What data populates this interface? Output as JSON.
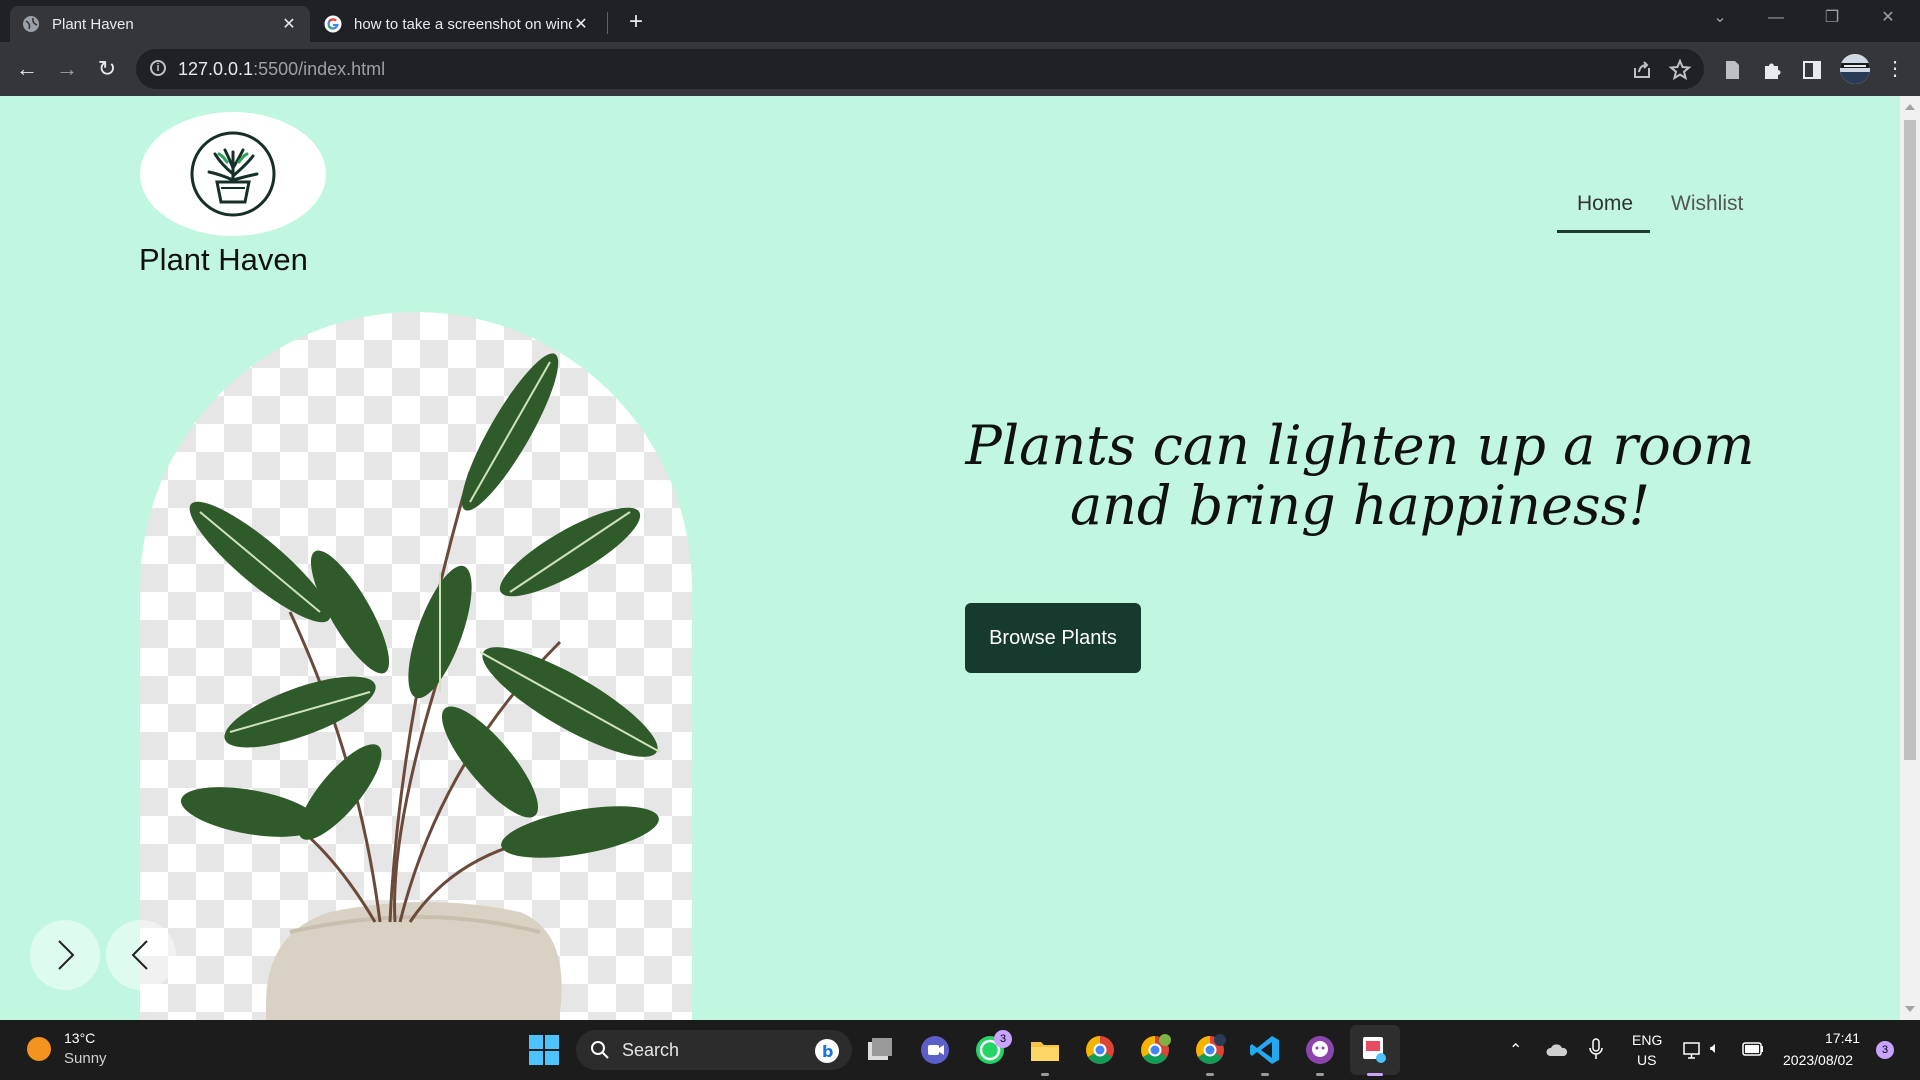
{
  "browser": {
    "tabs": [
      {
        "title": "Plant Haven",
        "active": true
      },
      {
        "title": "how to take a screenshot on windows",
        "active": false
      }
    ],
    "url_host": "127.0.0.1",
    "url_path": ":5500/index.html"
  },
  "page": {
    "brand": "Plant Haven",
    "nav": [
      {
        "label": "Home",
        "active": true
      },
      {
        "label": "Wishlist",
        "active": false
      }
    ],
    "headline_line1": "Plants can lighten up a room",
    "headline_line2": "and bring happiness!",
    "cta_label": "Browse Plants",
    "colors": {
      "background": "#c1f7e1",
      "cta": "#173a2e",
      "nav_underline": "#1f3a2f"
    }
  },
  "taskbar": {
    "weather_temp": "13°C",
    "weather_desc": "Sunny",
    "search_label": "Search",
    "whatsapp_badge": "3",
    "lang_line1": "ENG",
    "lang_line2": "US",
    "time": "17:41",
    "date": "2023/08/02",
    "notification_count": "3"
  }
}
